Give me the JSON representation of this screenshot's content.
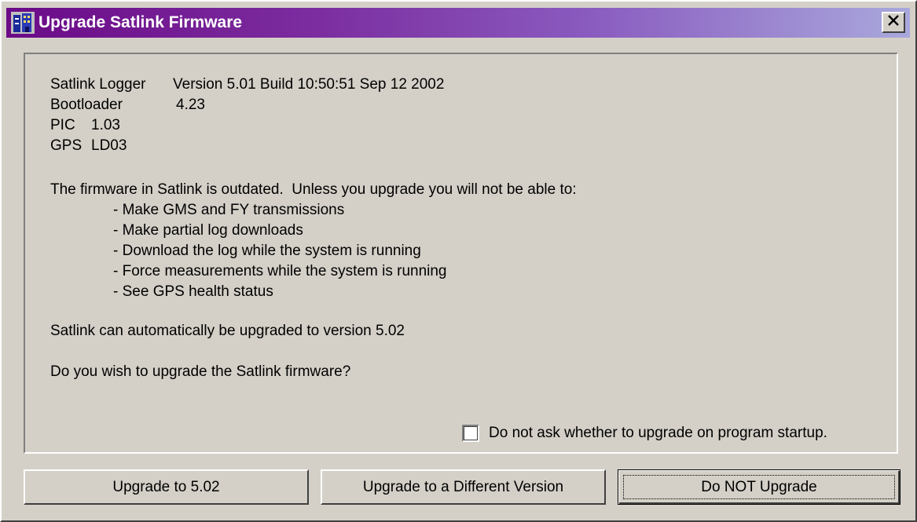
{
  "window": {
    "title": "Upgrade Satlink Firmware",
    "close_label": "×"
  },
  "info": {
    "logger_label": "Satlink Logger",
    "logger_value": "Version 5.01 Build 10:50:51 Sep 12 2002",
    "bootloader_label": "Bootloader",
    "bootloader_value": "4.23",
    "pic_label": "PIC",
    "pic_value": "1.03",
    "gps_label": "GPS",
    "gps_value": "LD03"
  },
  "message": {
    "intro": "The firmware in Satlink is outdated.  Unless you upgrade you will not be able to:",
    "items": [
      "- Make GMS and FY transmissions",
      "- Make partial log downloads",
      "- Download the log while the system is running",
      "- Force measurements while the system is running",
      "- See GPS health status"
    ],
    "auto_upgrade": "Satlink can automatically be upgraded to version 5.02",
    "question": "Do you wish to upgrade the Satlink firmware?"
  },
  "checkbox": {
    "label": "Do not ask whether to upgrade on program startup.",
    "checked": false
  },
  "buttons": {
    "upgrade": "Upgrade to 5.02",
    "different": "Upgrade to a Different Version",
    "do_not": "Do NOT Upgrade"
  }
}
